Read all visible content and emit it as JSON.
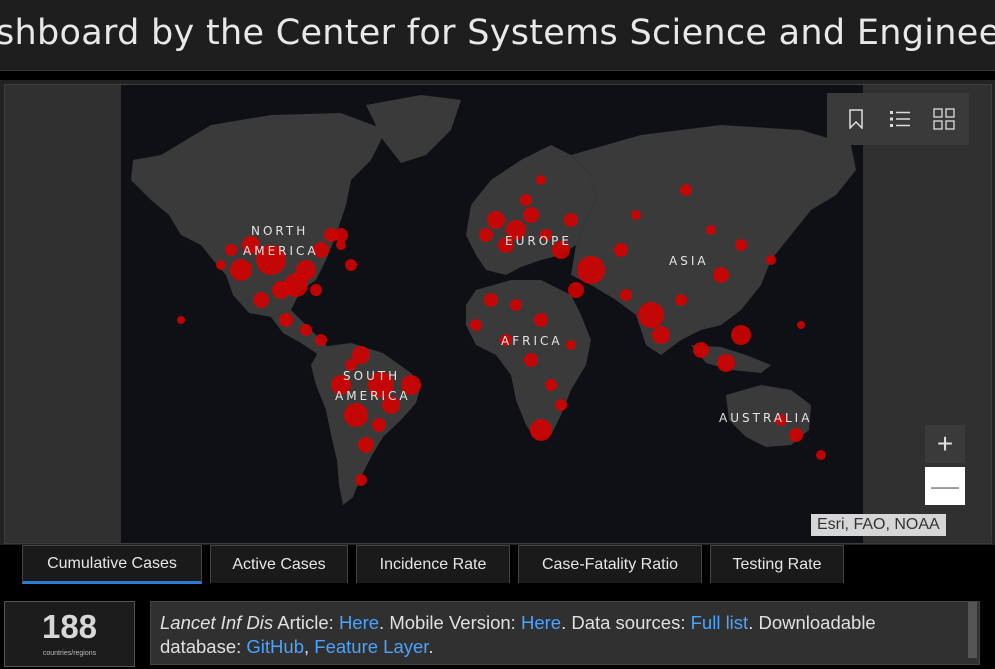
{
  "header": {
    "title": "shboard by the Center for Systems Science and Engineering (CS"
  },
  "map": {
    "labels": {
      "north_america_1": "NORTH",
      "north_america_2": "AMERICA",
      "europe": "EUROPE",
      "asia": "ASIA",
      "africa": "AFRICA",
      "south_america_1": "SOUTH",
      "south_america_2": "AMERICA",
      "australia": "AUSTRALIA"
    },
    "attribution": "Esri, FAO, NOAA",
    "toolbar": {
      "bookmark_icon": "bookmark-icon",
      "legend_icon": "legend-list-icon",
      "basemap_icon": "basemap-gallery-icon"
    },
    "zoom_in": "+",
    "zoom_out": "—",
    "colors": {
      "ocean": "#0e1016",
      "land": "#3a3a3a",
      "marker": "#d60000"
    }
  },
  "tabs": [
    {
      "label": "Cumulative Cases",
      "active": true
    },
    {
      "label": "Active Cases",
      "active": false
    },
    {
      "label": "Incidence Rate",
      "active": false
    },
    {
      "label": "Case-Fatality Ratio",
      "active": false
    },
    {
      "label": "Testing Rate",
      "active": false
    }
  ],
  "stats": {
    "count": "188",
    "count_label": "countries/regions"
  },
  "info": {
    "article_title": "Lancet Inf Dis",
    "article_suffix": " Article: ",
    "link_here_1": "Here",
    "mobile_text": ". Mobile Version: ",
    "link_here_2": "Here",
    "sources_text": ". Data sources: ",
    "link_full_list": "Full list",
    "download_text": ". Downloadable database: ",
    "link_github": "GitHub",
    "comma": ", ",
    "link_feature_layer": "Feature Layer",
    "end": "."
  },
  "accent_color": "#2f7ad8",
  "link_color": "#4aa3ff"
}
